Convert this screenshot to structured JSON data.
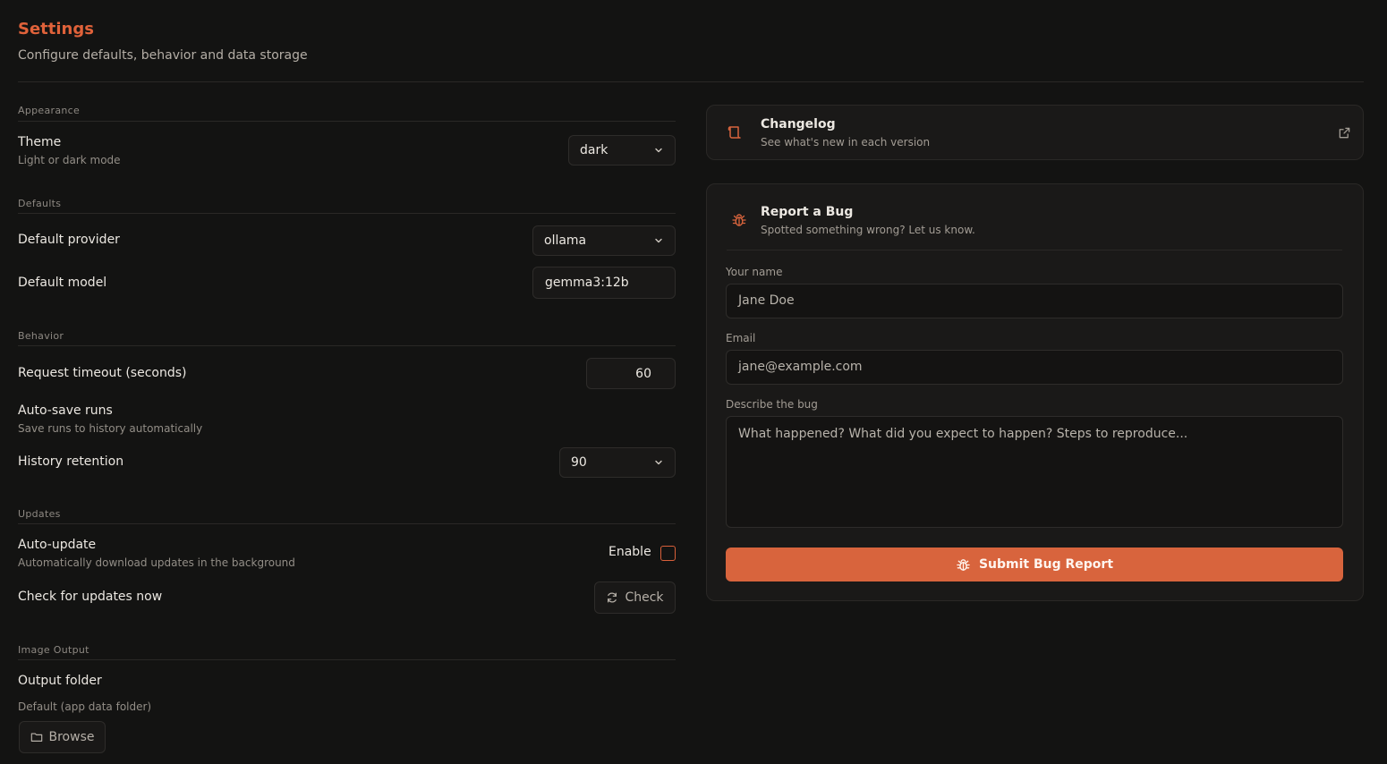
{
  "header": {
    "title": "Settings",
    "subtitle": "Configure defaults, behavior and data storage"
  },
  "appearance": {
    "section_label": "Appearance",
    "theme": {
      "label": "Theme",
      "description": "Light or dark mode",
      "value": "dark"
    }
  },
  "defaults": {
    "section_label": "Defaults",
    "provider": {
      "label": "Default provider",
      "value": "ollama"
    },
    "model": {
      "label": "Default model",
      "value": "gemma3:12b"
    }
  },
  "behavior": {
    "section_label": "Behavior",
    "timeout": {
      "label": "Request timeout (seconds)",
      "value": "60"
    },
    "autosave": {
      "label": "Auto-save runs",
      "description": "Save runs to history automatically"
    },
    "retention": {
      "label": "History retention",
      "value": "90"
    }
  },
  "updates": {
    "section_label": "Updates",
    "auto_update": {
      "label": "Auto-update",
      "description": "Automatically download updates in the background",
      "toggle_label": "Enable",
      "checked": false
    },
    "check": {
      "label": "Check for updates now",
      "button": "Check"
    }
  },
  "image_output": {
    "section_label": "Image Output",
    "folder": {
      "label": "Output folder",
      "description": "Default (app data folder)",
      "button": "Browse"
    }
  },
  "changelog": {
    "title": "Changelog",
    "subtitle": "See what's new in each version",
    "icons": {
      "leading": "scroll-icon",
      "trailing": "external-link-icon"
    }
  },
  "bug_report": {
    "title": "Report a Bug",
    "subtitle": "Spotted something wrong? Let us know.",
    "name_label": "Your name",
    "name_placeholder": "Jane Doe",
    "email_label": "Email",
    "email_placeholder": "jane@example.com",
    "description_label": "Describe the bug",
    "description_placeholder": "What happened? What did you expect to happen? Steps to reproduce...",
    "submit_label": "Submit Bug Report",
    "icon": "bug-icon"
  },
  "colors": {
    "accent": "#d8643d",
    "title": "#e0623a",
    "background": "#131312"
  }
}
